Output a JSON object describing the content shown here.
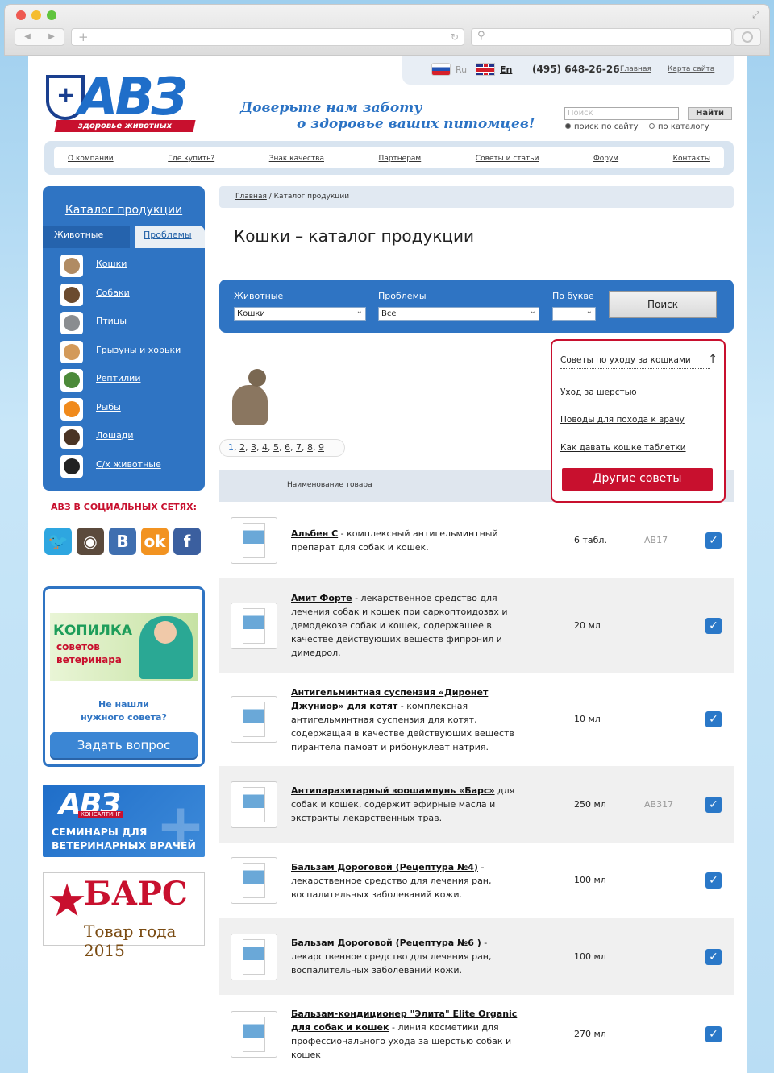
{
  "header": {
    "lang_ru": "Ru",
    "lang_en": "En",
    "phone": "(495) 648-26-26",
    "link_home": "Главная",
    "link_sitemap": "Карта сайта",
    "logo_text": "АВЗ",
    "logo_sub": "здоровье животных",
    "slogan_line1": "Доверьте нам заботу",
    "slogan_line2": "о здоровье ваших питомцев!",
    "search_placeholder": "Поиск",
    "search_button": "Найти",
    "radio_site": "поиск по сайту",
    "radio_catalog": "по каталогу"
  },
  "nav": [
    "О компании",
    "Где купить?",
    "Знак качества",
    "Партнерам",
    "Советы и статьи",
    "Форум",
    "Контакты"
  ],
  "sidebar": {
    "title": "Каталог продукции",
    "tab_animals": "Животные",
    "tab_problems": "Проблемы",
    "items": [
      {
        "label": "Кошки",
        "color": "#b08b63"
      },
      {
        "label": "Собаки",
        "color": "#6b4b2f"
      },
      {
        "label": "Птицы",
        "color": "#8a8d90"
      },
      {
        "label": "Грызуны и хорьки",
        "color": "#d39a5a"
      },
      {
        "label": "Рептилии",
        "color": "#4c8a3a"
      },
      {
        "label": "Рыбы",
        "color": "#f08a1c"
      },
      {
        "label": "Лошади",
        "color": "#4a3424"
      },
      {
        "label": "С/х животные",
        "color": "#222222"
      }
    ],
    "social_title": "АВЗ В СОЦИАЛЬНЫХ СЕТЯХ:",
    "social": [
      {
        "icon": "twitter-icon",
        "glyph": "🐦",
        "color": "#2ea6e0"
      },
      {
        "icon": "instagram-icon",
        "glyph": "◉",
        "color": "#5b4a3c"
      },
      {
        "icon": "vk-icon",
        "glyph": "В",
        "color": "#3f6fb0"
      },
      {
        "icon": "odnoklassniki-icon",
        "glyph": "ok",
        "color": "#f29321"
      },
      {
        "icon": "facebook-icon",
        "glyph": "f",
        "color": "#3b5f9f"
      }
    ],
    "advice_k1": "КОПИЛКА",
    "advice_k2": "советов",
    "advice_k3": "ветеринара",
    "advice_q1": "Не нашли",
    "advice_q2": "нужного совета?",
    "ask_button": "Задать вопрос",
    "seminar_logo": "АВЗ",
    "seminar_cons": "КОНСАЛТИНГ",
    "seminar_t1": "СЕМИНАРЫ ДЛЯ",
    "seminar_t2": "ВЕТЕРИНАРНЫХ ВРАЧЕЙ",
    "bars_title": "БАРС",
    "bars_sub": "Товар года 2015"
  },
  "main": {
    "crumb_home": "Главная",
    "crumb_sep": "/",
    "crumb_current": "Каталог продукции",
    "title": "Кошки – каталог продукции",
    "filter": {
      "animals_label": "Животные",
      "animals_value": "Кошки",
      "problems_label": "Проблемы",
      "problems_value": "Все",
      "letter_label": "По букве",
      "letter_value": "",
      "button": "Поиск"
    },
    "pages": [
      "1",
      "2",
      "3",
      "4",
      "5",
      "6",
      "7",
      "8",
      "9"
    ],
    "tips": {
      "title": "Советы по уходу за кошками",
      "items": [
        "Уход за шерстью",
        "Поводы для похода к врачу",
        "Как давать кошке таблетки"
      ],
      "more": "Другие советы"
    },
    "table_header": "Наименование товара",
    "products": [
      {
        "name": "Альбен С",
        "text": " - комплексный антигельминтный препарат для собак и кошек.",
        "qty": "6 табл.",
        "code": "АВ17"
      },
      {
        "name": "Амит Форте",
        "text": " - лекарственное средство для лечения собак и кошек при саркоптоидозах и демодекозе собак и кошек, содержащее в качестве действующих веществ фипронил и димедрол.",
        "qty": "20 мл",
        "code": ""
      },
      {
        "name": "Антигельминтная суспензия «Диронет Джуниор» для котят",
        "text": " - комплексная антигельминтная суспензия для котят, содержащая в качестве действующих веществ пирантела памоат и рибонуклеат натрия.",
        "qty": "10 мл",
        "code": ""
      },
      {
        "name": "Антипаразитарный зоошампунь «Барс»",
        "text": " для собак и кошек, содержит эфирные масла и экстракты лекарственных трав.",
        "qty": "250 мл",
        "code": "АВ317"
      },
      {
        "name": "Бальзам Дороговой (Рецептура №4)",
        "text": " - лекарственное средство для лечения ран, воспалительных заболеваний кожи.",
        "qty": "100 мл",
        "code": ""
      },
      {
        "name": "Бальзам Дороговой (Рецептура №6 )",
        "text": " - лекарственное средство для лечения ран, воспалительных заболеваний кожи.",
        "qty": "100 мл",
        "code": ""
      },
      {
        "name": "Бальзам-кондиционер \"Элита\" Elite Organic для собак и кошек",
        "text": " - линия косметики для профессионального ухода за шерстью собак и кошек",
        "qty": "270 мл",
        "code": ""
      }
    ]
  }
}
